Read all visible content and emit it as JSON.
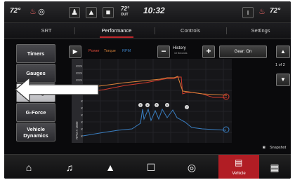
{
  "status_bar": {
    "left_temp": "72°",
    "outside_temp": "72°",
    "outside_label": "OUT",
    "time": "10:32",
    "right_temp": "72°"
  },
  "tabs": [
    "SRT",
    "Performance",
    "Controls",
    "Settings"
  ],
  "active_tab": "Performance",
  "side_buttons": [
    {
      "label": "Timers"
    },
    {
      "label": "Gauges"
    },
    {
      "label": "Dyno/Engine"
    },
    {
      "label": "G-Force"
    },
    {
      "label": "Vehicle Dynamics"
    }
  ],
  "graph": {
    "legend": {
      "power": "Power",
      "torque": "Torque",
      "rpm": "RPM"
    },
    "history_label": "History",
    "history_sub": "10 Seconds",
    "gear_label": "Gear: On",
    "axis_upper_ticks": [
      "XXX",
      "XXX",
      "XXX"
    ],
    "axis_lower_ticks": [
      "X",
      "X",
      "X",
      "X",
      "X",
      "X"
    ],
    "axis_lower_label": "RPM X 1000",
    "shift_markers": [
      "3",
      "4",
      "5",
      "6",
      "7"
    ],
    "colors": {
      "power": "#d23a2c",
      "torque": "#d9833a",
      "rpm": "#3a7fc2"
    }
  },
  "pager": "1 of 2",
  "snapshot_label": "Snapshot",
  "bottom_nav": {
    "vehicle_label": "Vehicle",
    "icons": [
      "home-icon",
      "music-icon",
      "navigation-icon",
      "phone-icon",
      "apps-circle-icon",
      "vehicle-icon",
      "grid-menu-icon"
    ]
  },
  "callout": "arrow pointing at Dyno/Engine button"
}
